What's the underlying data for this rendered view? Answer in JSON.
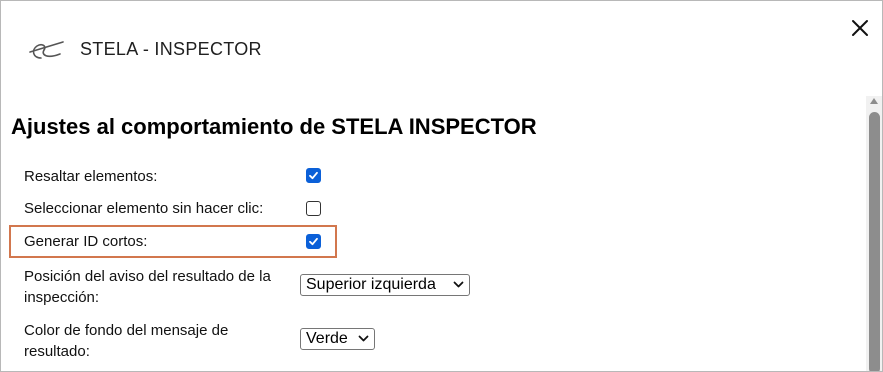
{
  "window": {
    "title": "STELA - INSPECTOR",
    "logo_icon": "stela-logo-icon",
    "close_icon": "close-icon"
  },
  "settings": {
    "heading": "Ajustes al comportamiento de STELA INSPECTOR",
    "highlight_elements": {
      "label": "Resaltar elementos:",
      "checked": true
    },
    "select_without_click": {
      "label": "Seleccionar elemento sin hacer clic:",
      "checked": false
    },
    "short_ids": {
      "label": "Generar ID cortos:",
      "checked": true,
      "highlighted": true
    },
    "notice_position": {
      "label_line1": "Posición del aviso del resultado de la",
      "label_line2": "inspección:",
      "value": "Superior izquierda"
    },
    "background_color": {
      "label_line1": "Color de fondo del mensaje de",
      "label_line2": "resultado:",
      "value": "Verde"
    }
  },
  "colors": {
    "checkbox_accent": "#0b60d8",
    "highlight_border": "#d2774e",
    "scrollbar_thumb": "#8d8d8d"
  }
}
